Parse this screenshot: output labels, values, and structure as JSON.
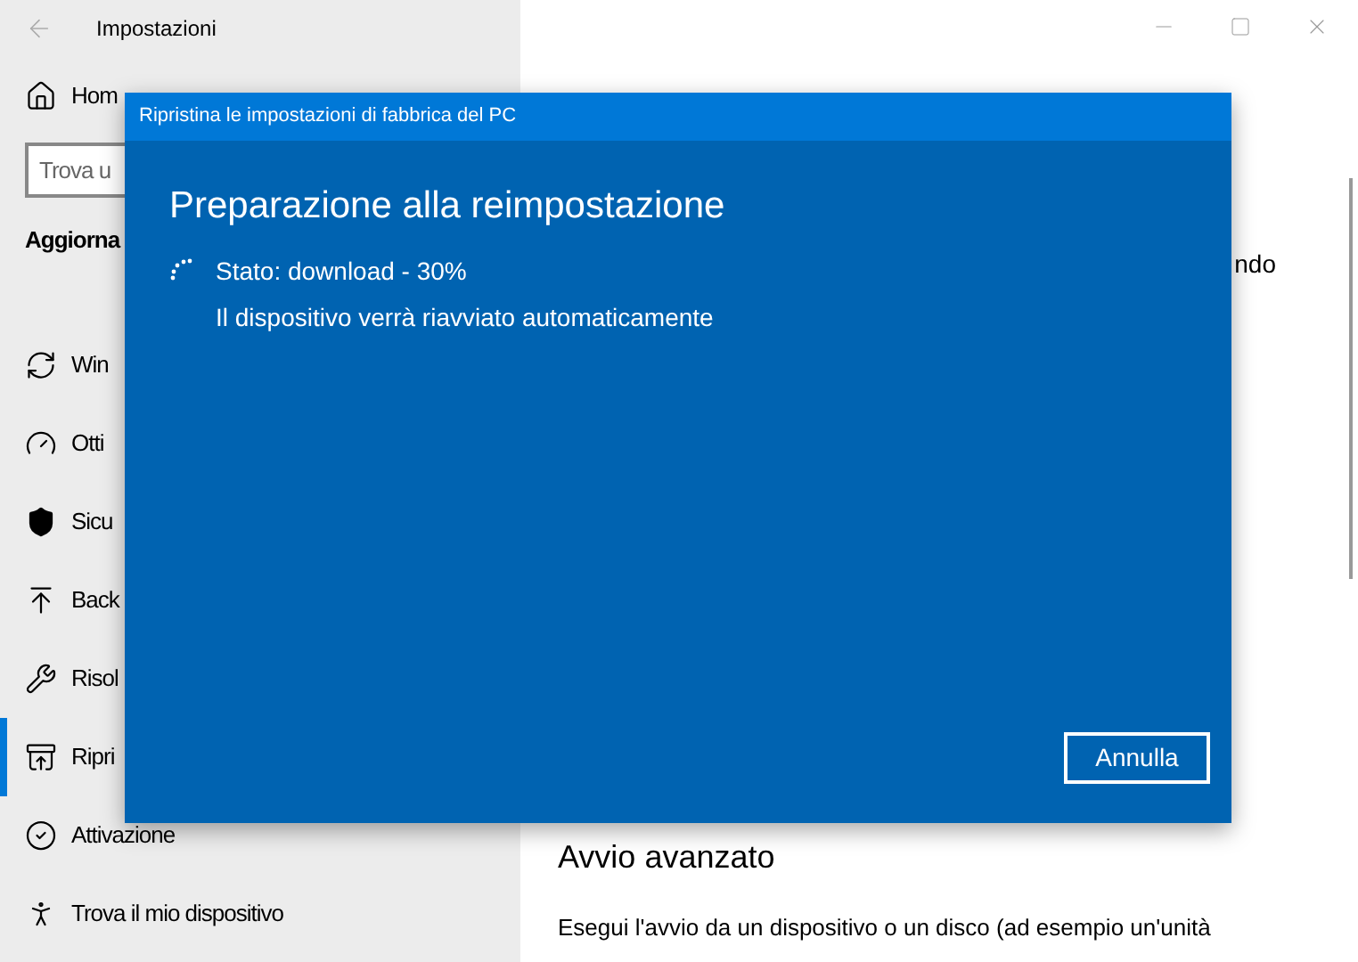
{
  "window": {
    "title": "Impostazioni"
  },
  "sidebar": {
    "home": "Hom",
    "search": {
      "placeholder": "Trova u"
    },
    "section": "Aggiorna",
    "items": [
      {
        "kind": "update",
        "label": "Win",
        "selected": false
      },
      {
        "kind": "optimize",
        "label": "Otti",
        "selected": false
      },
      {
        "kind": "security",
        "label": "Sicu",
        "selected": false
      },
      {
        "kind": "backup",
        "label": "Back",
        "selected": false
      },
      {
        "kind": "troubleshoot",
        "label": "Risol",
        "selected": false
      },
      {
        "kind": "recovery",
        "label": "Ripri",
        "selected": true
      },
      {
        "kind": "activation",
        "label": "Attivazione",
        "selected": false
      },
      {
        "kind": "find",
        "label": "Trova il mio dispositivo",
        "selected": false
      }
    ]
  },
  "content": {
    "fragment": "ndo",
    "heading": "Avvio avanzato",
    "lines": [
      "Esegui l'avvio da un dispositivo o un disco (ad esempio un'unità"
    ]
  },
  "dialog": {
    "title": "Ripristina le impostazioni di fabbrica del PC",
    "heading": "Preparazione alla reimpostazione",
    "status": "Stato: download - 30%",
    "note": "Il dispositivo verrà riavviato automaticamente",
    "button": "Annulla"
  }
}
